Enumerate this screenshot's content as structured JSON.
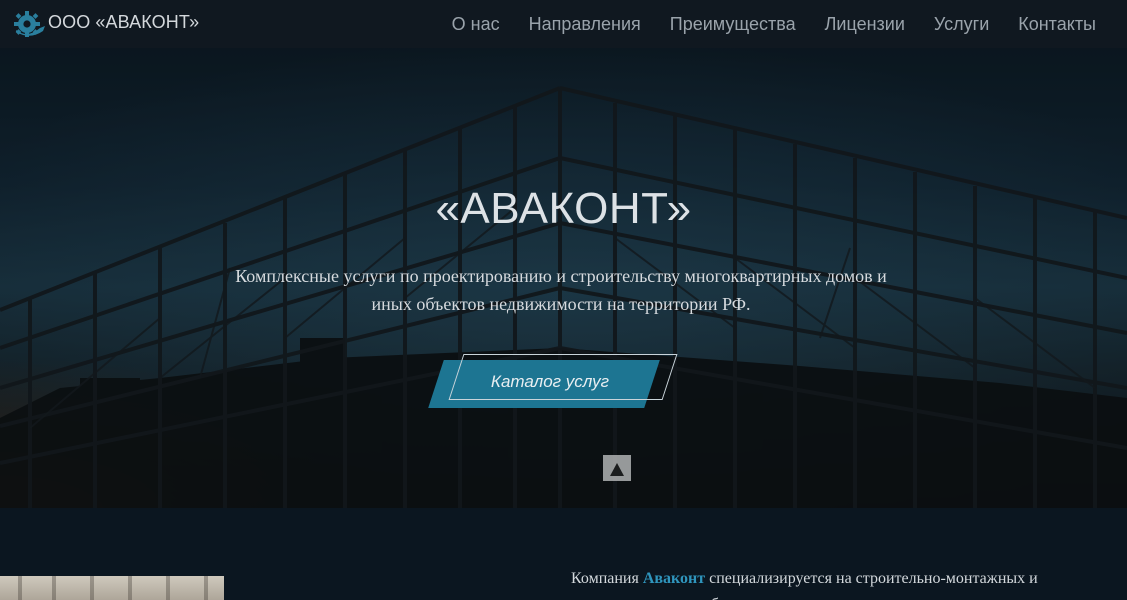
{
  "header": {
    "brand": "ООО «АВАКОНТ»",
    "nav": [
      "О нас",
      "Направления",
      "Преимущества",
      "Лицензии",
      "Услуги",
      "Контакты"
    ]
  },
  "hero": {
    "title": "«АВАКОНТ»",
    "subtitle": "Комплексные услуги по проектированию и строительству многоквартирных домов и иных объектов недвижимости на территории РФ.",
    "cta_label": "Каталог услуг"
  },
  "about": {
    "text_prefix": "Компания ",
    "company": "Аваконт",
    "text_rest": " специализируется на строительно-монтажных и пусконаладочных работах, кроме"
  },
  "colors": {
    "header_bg": "#101820",
    "accent": "#1d7592",
    "highlight": "#2f95bd",
    "page_bg": "#0b1620"
  },
  "icons": {
    "logo": "gear-logo-icon"
  }
}
